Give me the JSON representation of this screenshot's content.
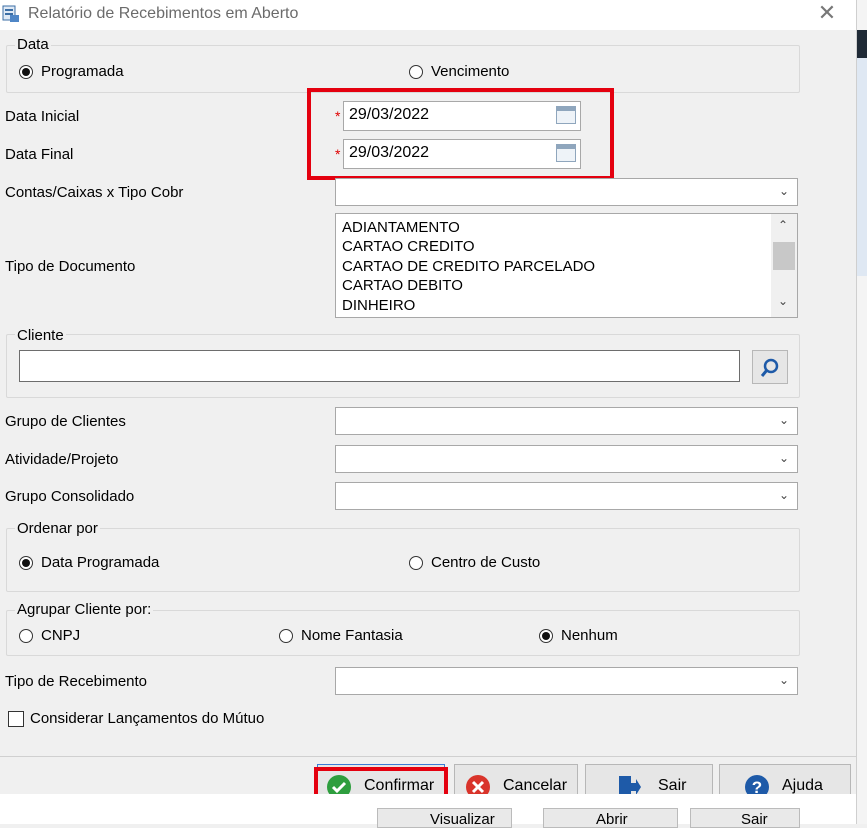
{
  "window": {
    "title": "Relatório de Recebimentos em Aberto",
    "close_glyph": "✕"
  },
  "data_group": {
    "legend": "Data",
    "options": [
      {
        "label": "Programada",
        "selected": true
      },
      {
        "label": "Vencimento",
        "selected": false
      }
    ]
  },
  "dates": {
    "start_label": "Data Inicial",
    "start_value": "29/03/2022",
    "end_label": "Data Final",
    "end_value": "29/03/2022",
    "required_mark": "*"
  },
  "contas": {
    "label": "Contas/Caixas x Tipo Cobr",
    "value": ""
  },
  "tipo_documento": {
    "label": "Tipo de Documento",
    "items": [
      "ADIANTAMENTO",
      "CARTAO CREDITO",
      "CARTAO DE CREDITO PARCELADO",
      "CARTAO DEBITO",
      "DINHEIRO"
    ]
  },
  "cliente": {
    "legend": "Cliente",
    "value": ""
  },
  "grupo_clientes": {
    "label": "Grupo de Clientes",
    "value": ""
  },
  "atividade": {
    "label": "Atividade/Projeto",
    "value": ""
  },
  "grupo_consolidado": {
    "label": "Grupo Consolidado",
    "value": ""
  },
  "ordenar": {
    "legend": "Ordenar por",
    "options": [
      {
        "label": "Data Programada",
        "selected": true
      },
      {
        "label": "Centro de Custo",
        "selected": false
      }
    ]
  },
  "agrupar": {
    "legend": "Agrupar Cliente por:",
    "options": [
      {
        "label": "CNPJ",
        "selected": false
      },
      {
        "label": "Nome Fantasia",
        "selected": false
      },
      {
        "label": "Nenhum",
        "selected": true
      }
    ]
  },
  "tipo_recebimento": {
    "label": "Tipo de Recebimento",
    "value": ""
  },
  "mutuo": {
    "label": "Considerar Lançamentos do Mútuo",
    "checked": false
  },
  "buttons": {
    "confirmar": "Confirmar",
    "cancelar": "Cancelar",
    "sair": "Sair",
    "ajuda": "Ajuda"
  },
  "background_buttons": {
    "visualizar": "Visualizar",
    "abrir": "Abrir",
    "sair": "Sair"
  },
  "colors": {
    "highlight": "#e4000f",
    "confirm_green": "#2e9e3e",
    "cancel_red": "#d9342b",
    "help_blue": "#1e5aa8"
  }
}
